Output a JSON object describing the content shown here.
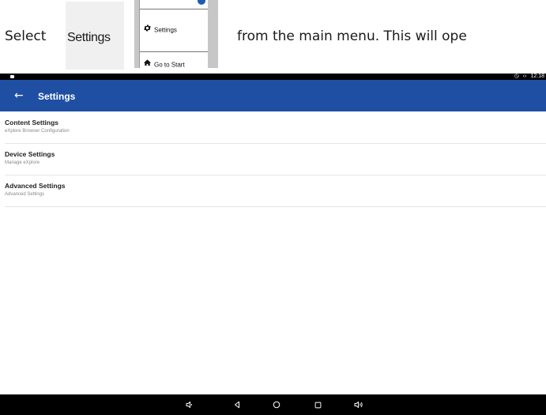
{
  "instruction": {
    "select": "Select",
    "settings_chip": "Settings",
    "rest": "from the main menu. This will ope"
  },
  "menu_thumbnail": {
    "items": [
      {
        "label": "Settings",
        "icon": "gear-icon"
      },
      {
        "label": "Go to Start",
        "icon": "home-icon"
      }
    ]
  },
  "status_bar": {
    "time": "12:18",
    "icons": [
      "alarm-icon",
      "code-icon"
    ]
  },
  "app_bar": {
    "back_icon": "←",
    "title": "Settings"
  },
  "settings_list": [
    {
      "title": "Content Settings",
      "subtitle": "eXplore Browser Configuration"
    },
    {
      "title": "Device Settings",
      "subtitle": "Manage eXplore"
    },
    {
      "title": "Advanced Settings",
      "subtitle": "Advanced Settings"
    }
  ],
  "nav_bar": {
    "buttons": [
      "volume-down-icon",
      "back-icon",
      "home-icon",
      "recents-icon",
      "volume-up-icon"
    ]
  },
  "colors": {
    "app_bar": "#1f4fa3",
    "system_bars": "#000000"
  }
}
